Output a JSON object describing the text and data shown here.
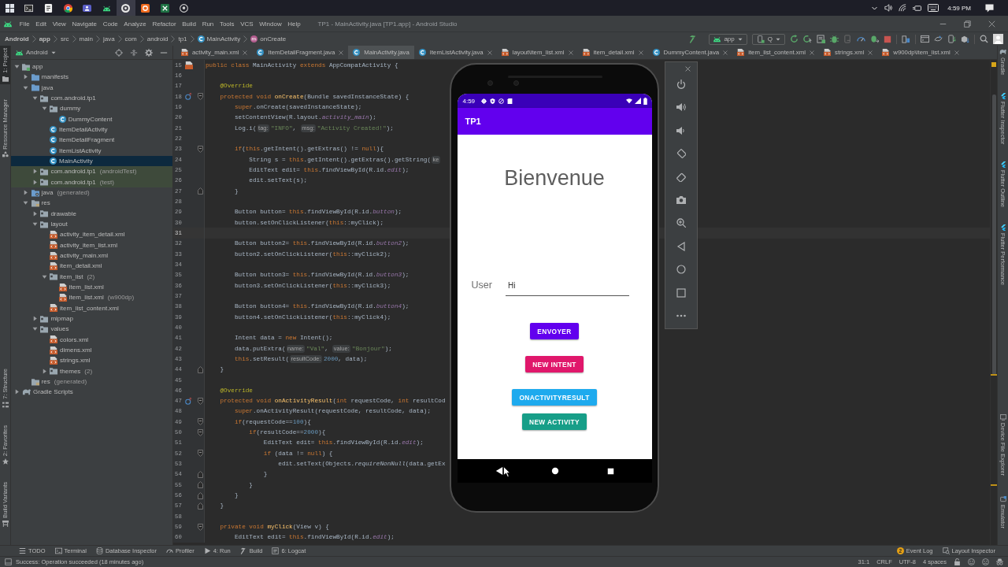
{
  "taskbar": {
    "apps": [
      {
        "kind": "start",
        "selected": false
      },
      {
        "kind": "terminal",
        "selected": false
      },
      {
        "kind": "notes",
        "selected": false
      },
      {
        "kind": "browser",
        "selected": false
      },
      {
        "kind": "chat",
        "selected": false
      },
      {
        "kind": "android",
        "selected": false
      },
      {
        "kind": "recorder",
        "selected": true
      },
      {
        "kind": "office",
        "selected": false
      },
      {
        "kind": "spreadsheet",
        "selected": false
      },
      {
        "kind": "git",
        "selected": false
      }
    ],
    "clock": "4:59 PM"
  },
  "menu_bar": {
    "items": [
      "File",
      "Edit",
      "View",
      "Navigate",
      "Code",
      "Analyze",
      "Refactor",
      "Build",
      "Run",
      "Tools",
      "VCS",
      "Window",
      "Help"
    ],
    "title": "TP1 - MainActivity.java [TP1.app] - Android Studio"
  },
  "breadcrumb": [
    {
      "label": "Android",
      "kind": "root"
    },
    {
      "label": "app",
      "kind": "module"
    },
    {
      "label": "src",
      "kind": "folder"
    },
    {
      "label": "main",
      "kind": "folder"
    },
    {
      "label": "java",
      "kind": "folder"
    },
    {
      "label": "com",
      "kind": "folder"
    },
    {
      "label": "android",
      "kind": "folder"
    },
    {
      "label": "tp1",
      "kind": "folder"
    },
    {
      "label": "MainActivity",
      "kind": "class"
    },
    {
      "label": "onCreate",
      "kind": "method"
    }
  ],
  "toolbar": {
    "run_config": "app",
    "device": "Q"
  },
  "left_strip": {
    "top": [
      {
        "label": "1: Project",
        "kind": "project",
        "selected": true
      },
      {
        "label": "Resource Manager",
        "kind": "resources",
        "selected": false
      }
    ],
    "bottom": [
      {
        "label": "7: Structure",
        "kind": "structure",
        "selected": false
      },
      {
        "label": "2: Favorites",
        "kind": "favorites",
        "selected": false
      },
      {
        "label": "Build Variants",
        "kind": "variants",
        "selected": false
      }
    ]
  },
  "project_panel": {
    "view": "Android",
    "tree": [
      {
        "label": "app",
        "kind": "module",
        "expanded": true,
        "selected": false,
        "children": [
          {
            "label": "manifests",
            "kind": "source-folder",
            "expanded": false,
            "selected": false
          },
          {
            "label": "java",
            "kind": "source-folder",
            "expanded": true,
            "selected": false,
            "children": [
              {
                "label": "com.android.tp1",
                "kind": "folder",
                "expanded": true,
                "selected": false,
                "children": [
                  {
                    "label": "dummy",
                    "kind": "folder",
                    "expanded": true,
                    "selected": false,
                    "children": [
                      {
                        "label": "DummyContent",
                        "kind": "class",
                        "selected": false
                      }
                    ]
                  },
                  {
                    "label": "ItemDetailActivity",
                    "kind": "class",
                    "selected": false
                  },
                  {
                    "label": "ItemDetailFragment",
                    "kind": "class",
                    "selected": false
                  },
                  {
                    "label": "ItemListActivity",
                    "kind": "class",
                    "selected": false
                  },
                  {
                    "label": "MainActivity",
                    "kind": "class",
                    "selected": true
                  }
                ]
              },
              {
                "label": "com.android.tp1",
                "note": "(androidTest)",
                "kind": "test-folder",
                "expanded": false,
                "selected": false
              },
              {
                "label": "com.android.tp1",
                "note": "(test)",
                "kind": "test-folder",
                "expanded": false,
                "selected": false
              }
            ]
          },
          {
            "label": "java",
            "note": "(generated)",
            "kind": "generated-folder",
            "expanded": false,
            "selected": false
          },
          {
            "label": "res",
            "kind": "res-folder",
            "expanded": true,
            "selected": false,
            "children": [
              {
                "label": "drawable",
                "kind": "folder",
                "expanded": false,
                "selected": false
              },
              {
                "label": "layout",
                "kind": "folder",
                "expanded": true,
                "selected": false,
                "children": [
                  {
                    "label": "activity_item_detail.xml",
                    "kind": "xml",
                    "selected": false
                  },
                  {
                    "label": "activity_item_list.xml",
                    "kind": "xml",
                    "selected": false
                  },
                  {
                    "label": "activity_main.xml",
                    "kind": "xml",
                    "selected": false
                  },
                  {
                    "label": "item_detail.xml",
                    "kind": "xml",
                    "selected": false
                  },
                  {
                    "label": "item_list",
                    "note": "(2)",
                    "kind": "folder",
                    "expanded": true,
                    "selected": false,
                    "children": [
                      {
                        "label": "item_list.xml",
                        "kind": "xml",
                        "selected": false
                      },
                      {
                        "label": "item_list.xml",
                        "note": "(w900dp)",
                        "kind": "xml",
                        "selected": false
                      }
                    ]
                  },
                  {
                    "label": "item_list_content.xml",
                    "kind": "xml",
                    "selected": false
                  }
                ]
              },
              {
                "label": "mipmap",
                "kind": "folder",
                "expanded": false,
                "selected": false
              },
              {
                "label": "values",
                "kind": "folder",
                "expanded": true,
                "selected": false,
                "children": [
                  {
                    "label": "colors.xml",
                    "kind": "xml",
                    "selected": false
                  },
                  {
                    "label": "dimens.xml",
                    "kind": "xml",
                    "selected": false
                  },
                  {
                    "label": "strings.xml",
                    "kind": "xml",
                    "selected": false
                  },
                  {
                    "label": "themes",
                    "note": "(2)",
                    "kind": "folder",
                    "expanded": false,
                    "selected": false
                  }
                ]
              }
            ]
          },
          {
            "label": "res",
            "note": "(generated)",
            "kind": "res-generated",
            "selected": false
          }
        ]
      },
      {
        "label": "Gradle Scripts",
        "kind": "gradle",
        "expanded": false,
        "selected": false
      }
    ]
  },
  "editor_tabs": [
    {
      "label": "activity_main.xml",
      "kind": "xml",
      "selected": false
    },
    {
      "label": "ItemDetailFragment.java",
      "kind": "class",
      "selected": false
    },
    {
      "label": "MainActivity.java",
      "kind": "class",
      "selected": true
    },
    {
      "label": "ItemListActivity.java",
      "kind": "class",
      "selected": false
    },
    {
      "label": "layout\\item_list.xml",
      "kind": "xml",
      "selected": false
    },
    {
      "label": "item_detail.xml",
      "kind": "xml",
      "selected": false
    },
    {
      "label": "DummyContent.java",
      "kind": "class",
      "selected": false
    },
    {
      "label": "item_list_content.xml",
      "kind": "xml",
      "selected": false
    },
    {
      "label": "strings.xml",
      "kind": "xml",
      "selected": false
    },
    {
      "label": "w900dp\\item_list.xml",
      "kind": "xml",
      "selected": false
    }
  ],
  "code_lines": [
    {
      "number": "15",
      "current": false,
      "gutter": {
        "kind": "layout"
      },
      "tokens": [
        {
          "kind": "keyword",
          "text": "public class "
        },
        {
          "kind": "plain",
          "text": "MainActivity "
        },
        {
          "kind": "keyword",
          "text": "extends "
        },
        {
          "kind": "plain",
          "text": "AppCompatActivity {"
        }
      ]
    },
    {
      "number": "16",
      "current": false
    },
    {
      "number": "17",
      "current": false,
      "tokens": [
        {
          "kind": "annotation",
          "text": "    @Override"
        }
      ]
    },
    {
      "number": "18",
      "current": false,
      "gutter": {
        "kind": "override"
      },
      "fold": {
        "kind": "start"
      },
      "tokens": [
        {
          "kind": "keyword",
          "text": "    protected void "
        },
        {
          "kind": "declaration",
          "text": "onCreate"
        },
        {
          "kind": "plain",
          "text": "(Bundle savedInstanceState) {"
        }
      ]
    },
    {
      "number": "19",
      "current": false,
      "tokens": [
        {
          "kind": "keyword",
          "text": "        super"
        },
        {
          "kind": "plain",
          "text": ".onCreate(savedInstanceState);"
        }
      ]
    },
    {
      "number": "20",
      "current": false,
      "tokens": [
        {
          "kind": "plain",
          "text": "        setContentView(R.layout."
        },
        {
          "kind": "field",
          "text": "activity_main"
        },
        {
          "kind": "plain",
          "text": ");"
        }
      ]
    },
    {
      "number": "21",
      "current": false,
      "tokens": [
        {
          "kind": "plain",
          "text": "        Log.i("
        },
        {
          "kind": "hint",
          "text": "tag:"
        },
        {
          "kind": "string",
          "text": "\"INFO\""
        },
        {
          "kind": "plain",
          "text": ", "
        },
        {
          "kind": "hint",
          "text": "msg:"
        },
        {
          "kind": "string",
          "text": "\"Activity Created!\""
        },
        {
          "kind": "plain",
          "text": ");"
        }
      ]
    },
    {
      "number": "22",
      "current": false
    },
    {
      "number": "23",
      "current": false,
      "fold": {
        "kind": "start"
      },
      "tokens": [
        {
          "kind": "keyword",
          "text": "        if"
        },
        {
          "kind": "plain",
          "text": "("
        },
        {
          "kind": "keyword",
          "text": "this"
        },
        {
          "kind": "plain",
          "text": ".getIntent().getExtras() != "
        },
        {
          "kind": "keyword",
          "text": "null"
        },
        {
          "kind": "plain",
          "text": "){"
        }
      ]
    },
    {
      "number": "24",
      "current": false,
      "tokens": [
        {
          "kind": "plain",
          "text": "            String s = "
        },
        {
          "kind": "keyword",
          "text": "this"
        },
        {
          "kind": "plain",
          "text": ".getIntent().getExtras().getString("
        },
        {
          "kind": "hint",
          "text": "ke"
        }
      ]
    },
    {
      "number": "25",
      "current": false,
      "tokens": [
        {
          "kind": "plain",
          "text": "            EditText edit= "
        },
        {
          "kind": "keyword",
          "text": "this"
        },
        {
          "kind": "plain",
          "text": ".findViewById(R.id."
        },
        {
          "kind": "field",
          "text": "edit"
        },
        {
          "kind": "plain",
          "text": ");"
        }
      ]
    },
    {
      "number": "26",
      "current": false,
      "tokens": [
        {
          "kind": "plain",
          "text": "            edit.setText(s);"
        }
      ]
    },
    {
      "number": "27",
      "current": false,
      "fold": {
        "kind": "end"
      },
      "tokens": [
        {
          "kind": "plain",
          "text": "        }"
        }
      ]
    },
    {
      "number": "28",
      "current": false
    },
    {
      "number": "29",
      "current": false,
      "tokens": [
        {
          "kind": "plain",
          "text": "        Button button= "
        },
        {
          "kind": "keyword",
          "text": "this"
        },
        {
          "kind": "plain",
          "text": ".findViewById(R.id."
        },
        {
          "kind": "field",
          "text": "button"
        },
        {
          "kind": "plain",
          "text": ");"
        }
      ]
    },
    {
      "number": "30",
      "current": false,
      "tokens": [
        {
          "kind": "plain",
          "text": "        button.setOnClickListener("
        },
        {
          "kind": "keyword",
          "text": "this"
        },
        {
          "kind": "plain",
          "text": "::myClick);"
        }
      ]
    },
    {
      "number": "31",
      "current": true
    },
    {
      "number": "32",
      "current": false,
      "tokens": [
        {
          "kind": "plain",
          "text": "        Button button2= "
        },
        {
          "kind": "keyword",
          "text": "this"
        },
        {
          "kind": "plain",
          "text": ".findViewById(R.id."
        },
        {
          "kind": "field",
          "text": "button2"
        },
        {
          "kind": "plain",
          "text": ");"
        }
      ]
    },
    {
      "number": "33",
      "current": false,
      "tokens": [
        {
          "kind": "plain",
          "text": "        button2.setOnClickListener("
        },
        {
          "kind": "keyword",
          "text": "this"
        },
        {
          "kind": "plain",
          "text": "::myClick2);"
        }
      ]
    },
    {
      "number": "34",
      "current": false
    },
    {
      "number": "35",
      "current": false,
      "tokens": [
        {
          "kind": "plain",
          "text": "        Button button3= "
        },
        {
          "kind": "keyword",
          "text": "this"
        },
        {
          "kind": "plain",
          "text": ".findViewById(R.id."
        },
        {
          "kind": "field",
          "text": "button3"
        },
        {
          "kind": "plain",
          "text": ");"
        }
      ]
    },
    {
      "number": "36",
      "current": false,
      "tokens": [
        {
          "kind": "plain",
          "text": "        button3.setOnClickListener("
        },
        {
          "kind": "keyword",
          "text": "this"
        },
        {
          "kind": "plain",
          "text": "::myClick3);"
        }
      ]
    },
    {
      "number": "37",
      "current": false
    },
    {
      "number": "38",
      "current": false,
      "tokens": [
        {
          "kind": "plain",
          "text": "        Button button4= "
        },
        {
          "kind": "keyword",
          "text": "this"
        },
        {
          "kind": "plain",
          "text": ".findViewById(R.id."
        },
        {
          "kind": "field",
          "text": "button4"
        },
        {
          "kind": "plain",
          "text": ");"
        }
      ]
    },
    {
      "number": "39",
      "current": false,
      "tokens": [
        {
          "kind": "plain",
          "text": "        button4.setOnClickListener("
        },
        {
          "kind": "keyword",
          "text": "this"
        },
        {
          "kind": "plain",
          "text": "::myClick4);"
        }
      ]
    },
    {
      "number": "40",
      "current": false
    },
    {
      "number": "41",
      "current": false,
      "tokens": [
        {
          "kind": "plain",
          "text": "        Intent data = "
        },
        {
          "kind": "keyword",
          "text": "new "
        },
        {
          "kind": "plain",
          "text": "Intent();"
        }
      ]
    },
    {
      "number": "42",
      "current": false,
      "tokens": [
        {
          "kind": "plain",
          "text": "        data.putExtra("
        },
        {
          "kind": "hint",
          "text": "name:"
        },
        {
          "kind": "string",
          "text": "\"Val\""
        },
        {
          "kind": "plain",
          "text": ", "
        },
        {
          "kind": "hint",
          "text": "value:"
        },
        {
          "kind": "string",
          "text": "\"Bonjour\""
        },
        {
          "kind": "plain",
          "text": ");"
        }
      ]
    },
    {
      "number": "43",
      "current": false,
      "tokens": [
        {
          "kind": "keyword",
          "text": "        this"
        },
        {
          "kind": "plain",
          "text": ".setResult("
        },
        {
          "kind": "hint",
          "text": "resultCode:"
        },
        {
          "kind": "number",
          "text": "2000"
        },
        {
          "kind": "plain",
          "text": ", data);"
        }
      ]
    },
    {
      "number": "44",
      "current": false,
      "fold": {
        "kind": "end"
      },
      "tokens": [
        {
          "kind": "plain",
          "text": "    }"
        }
      ]
    },
    {
      "number": "45",
      "current": false
    },
    {
      "number": "46",
      "current": false,
      "tokens": [
        {
          "kind": "annotation",
          "text": "    @Override"
        }
      ]
    },
    {
      "number": "47",
      "current": false,
      "gutter": {
        "kind": "override"
      },
      "fold": {
        "kind": "start"
      },
      "tokens": [
        {
          "kind": "keyword",
          "text": "    protected void "
        },
        {
          "kind": "declaration",
          "text": "onActivityResult"
        },
        {
          "kind": "plain",
          "text": "("
        },
        {
          "kind": "keyword",
          "text": "int "
        },
        {
          "kind": "plain",
          "text": "requestCode, "
        },
        {
          "kind": "keyword",
          "text": "int "
        },
        {
          "kind": "plain",
          "text": "resultCod"
        }
      ]
    },
    {
      "number": "48",
      "current": false,
      "tokens": [
        {
          "kind": "keyword",
          "text": "        super"
        },
        {
          "kind": "plain",
          "text": ".onActivityResult(requestCode, resultCode, data);"
        }
      ]
    },
    {
      "number": "49",
      "current": false,
      "fold": {
        "kind": "start"
      },
      "tokens": [
        {
          "kind": "keyword",
          "text": "        if"
        },
        {
          "kind": "plain",
          "text": "(requestCode=="
        },
        {
          "kind": "number",
          "text": "100"
        },
        {
          "kind": "plain",
          "text": "){"
        }
      ]
    },
    {
      "number": "50",
      "current": false,
      "fold": {
        "kind": "start"
      },
      "tokens": [
        {
          "kind": "keyword",
          "text": "            if"
        },
        {
          "kind": "plain",
          "text": "(resultCode=="
        },
        {
          "kind": "number",
          "text": "2000"
        },
        {
          "kind": "plain",
          "text": "){"
        }
      ]
    },
    {
      "number": "51",
      "current": false,
      "tokens": [
        {
          "kind": "plain",
          "text": "                EditText edit= "
        },
        {
          "kind": "keyword",
          "text": "this"
        },
        {
          "kind": "plain",
          "text": ".findViewById(R.id."
        },
        {
          "kind": "field",
          "text": "edit"
        },
        {
          "kind": "plain",
          "text": ");"
        }
      ]
    },
    {
      "number": "52",
      "current": false,
      "fold": {
        "kind": "start"
      },
      "tokens": [
        {
          "kind": "keyword",
          "text": "                if "
        },
        {
          "kind": "plain",
          "text": "(data != "
        },
        {
          "kind": "keyword",
          "text": "null"
        },
        {
          "kind": "plain",
          "text": ") {"
        }
      ]
    },
    {
      "number": "53",
      "current": false,
      "tokens": [
        {
          "kind": "plain",
          "text": "                    edit.setText(Objects."
        },
        {
          "kind": "static",
          "text": "requireNonNull"
        },
        {
          "kind": "plain",
          "text": "(data.getEx"
        }
      ]
    },
    {
      "number": "54",
      "current": false,
      "fold": {
        "kind": "end"
      },
      "tokens": [
        {
          "kind": "plain",
          "text": "                }"
        }
      ]
    },
    {
      "number": "55",
      "current": false,
      "fold": {
        "kind": "end"
      },
      "tokens": [
        {
          "kind": "plain",
          "text": "            }"
        }
      ]
    },
    {
      "number": "56",
      "current": false,
      "fold": {
        "kind": "end"
      },
      "tokens": [
        {
          "kind": "plain",
          "text": "        }"
        }
      ]
    },
    {
      "number": "57",
      "current": false,
      "fold": {
        "kind": "end"
      },
      "tokens": [
        {
          "kind": "plain",
          "text": "    }"
        }
      ]
    },
    {
      "number": "58",
      "current": false
    },
    {
      "number": "59",
      "current": false,
      "fold": {
        "kind": "start"
      },
      "tokens": [
        {
          "kind": "keyword",
          "text": "    private void "
        },
        {
          "kind": "declaration",
          "text": "myClick"
        },
        {
          "kind": "plain",
          "text": "(View v) {"
        }
      ]
    },
    {
      "number": "60",
      "current": false,
      "tokens": [
        {
          "kind": "plain",
          "text": "        EditText edit= "
        },
        {
          "kind": "keyword",
          "text": "this"
        },
        {
          "kind": "plain",
          "text": ".findViewById(R.id."
        },
        {
          "kind": "field",
          "text": "edit"
        },
        {
          "kind": "plain",
          "text": ");"
        }
      ]
    }
  ],
  "emulator": {
    "status_time": "4:59",
    "app_title": "TP1",
    "heading": "Bienvenue",
    "user_label": "User",
    "user_value": "Hi",
    "buttons": [
      {
        "label": "ENVOYER",
        "color": "#6200ee"
      },
      {
        "label": "NEW INTENT",
        "color": "#e0176b"
      },
      {
        "label": "ONACTIVITYRESULT",
        "color": "#1eaaee"
      },
      {
        "label": "NEW ACTIVITY",
        "color": "#179e88"
      }
    ]
  },
  "right_strip": {
    "top": [
      {
        "label": "Gradle",
        "kind": "gradle"
      },
      {
        "label": "Flutter Inspector",
        "kind": "flutter"
      },
      {
        "label": "Flutter Outline",
        "kind": "flutter"
      },
      {
        "label": "Flutter Performance",
        "kind": "flutter"
      }
    ],
    "bottom": [
      {
        "label": "Device File Explorer",
        "kind": "device-explorer"
      },
      {
        "label": "Emulator",
        "kind": "emulator"
      }
    ]
  },
  "tool_windows": {
    "left": [
      {
        "label": "TODO",
        "kind": "todo"
      },
      {
        "label": "Terminal",
        "kind": "terminal"
      },
      {
        "label": "Database Inspector",
        "kind": "database"
      },
      {
        "label": "Profiler",
        "kind": "profiler"
      },
      {
        "label": "4: Run",
        "kind": "run"
      },
      {
        "label": "Build",
        "kind": "build"
      },
      {
        "label": "6: Logcat",
        "kind": "logcat"
      }
    ],
    "right": [
      {
        "label": "Event Log",
        "kind": "event-log",
        "badge": "2"
      },
      {
        "label": "Layout Inspector",
        "kind": "layout-inspector"
      }
    ]
  },
  "status_bar": {
    "message": "Success: Operation succeeded (18 minutes ago)",
    "position": "31:1",
    "line_separator": "CRLF",
    "encoding": "UTF-8",
    "indent": "4 spaces"
  }
}
